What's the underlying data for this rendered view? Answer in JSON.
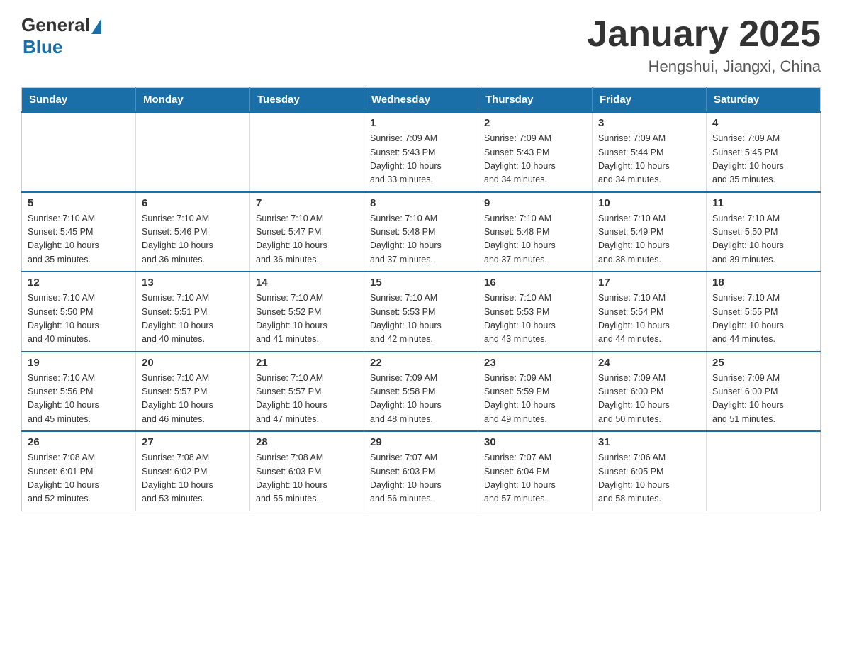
{
  "logo": {
    "general": "General",
    "blue": "Blue"
  },
  "title": "January 2025",
  "subtitle": "Hengshui, Jiangxi, China",
  "days_of_week": [
    "Sunday",
    "Monday",
    "Tuesday",
    "Wednesday",
    "Thursday",
    "Friday",
    "Saturday"
  ],
  "weeks": [
    [
      {
        "day": "",
        "info": ""
      },
      {
        "day": "",
        "info": ""
      },
      {
        "day": "",
        "info": ""
      },
      {
        "day": "1",
        "info": "Sunrise: 7:09 AM\nSunset: 5:43 PM\nDaylight: 10 hours\nand 33 minutes."
      },
      {
        "day": "2",
        "info": "Sunrise: 7:09 AM\nSunset: 5:43 PM\nDaylight: 10 hours\nand 34 minutes."
      },
      {
        "day": "3",
        "info": "Sunrise: 7:09 AM\nSunset: 5:44 PM\nDaylight: 10 hours\nand 34 minutes."
      },
      {
        "day": "4",
        "info": "Sunrise: 7:09 AM\nSunset: 5:45 PM\nDaylight: 10 hours\nand 35 minutes."
      }
    ],
    [
      {
        "day": "5",
        "info": "Sunrise: 7:10 AM\nSunset: 5:45 PM\nDaylight: 10 hours\nand 35 minutes."
      },
      {
        "day": "6",
        "info": "Sunrise: 7:10 AM\nSunset: 5:46 PM\nDaylight: 10 hours\nand 36 minutes."
      },
      {
        "day": "7",
        "info": "Sunrise: 7:10 AM\nSunset: 5:47 PM\nDaylight: 10 hours\nand 36 minutes."
      },
      {
        "day": "8",
        "info": "Sunrise: 7:10 AM\nSunset: 5:48 PM\nDaylight: 10 hours\nand 37 minutes."
      },
      {
        "day": "9",
        "info": "Sunrise: 7:10 AM\nSunset: 5:48 PM\nDaylight: 10 hours\nand 37 minutes."
      },
      {
        "day": "10",
        "info": "Sunrise: 7:10 AM\nSunset: 5:49 PM\nDaylight: 10 hours\nand 38 minutes."
      },
      {
        "day": "11",
        "info": "Sunrise: 7:10 AM\nSunset: 5:50 PM\nDaylight: 10 hours\nand 39 minutes."
      }
    ],
    [
      {
        "day": "12",
        "info": "Sunrise: 7:10 AM\nSunset: 5:50 PM\nDaylight: 10 hours\nand 40 minutes."
      },
      {
        "day": "13",
        "info": "Sunrise: 7:10 AM\nSunset: 5:51 PM\nDaylight: 10 hours\nand 40 minutes."
      },
      {
        "day": "14",
        "info": "Sunrise: 7:10 AM\nSunset: 5:52 PM\nDaylight: 10 hours\nand 41 minutes."
      },
      {
        "day": "15",
        "info": "Sunrise: 7:10 AM\nSunset: 5:53 PM\nDaylight: 10 hours\nand 42 minutes."
      },
      {
        "day": "16",
        "info": "Sunrise: 7:10 AM\nSunset: 5:53 PM\nDaylight: 10 hours\nand 43 minutes."
      },
      {
        "day": "17",
        "info": "Sunrise: 7:10 AM\nSunset: 5:54 PM\nDaylight: 10 hours\nand 44 minutes."
      },
      {
        "day": "18",
        "info": "Sunrise: 7:10 AM\nSunset: 5:55 PM\nDaylight: 10 hours\nand 44 minutes."
      }
    ],
    [
      {
        "day": "19",
        "info": "Sunrise: 7:10 AM\nSunset: 5:56 PM\nDaylight: 10 hours\nand 45 minutes."
      },
      {
        "day": "20",
        "info": "Sunrise: 7:10 AM\nSunset: 5:57 PM\nDaylight: 10 hours\nand 46 minutes."
      },
      {
        "day": "21",
        "info": "Sunrise: 7:10 AM\nSunset: 5:57 PM\nDaylight: 10 hours\nand 47 minutes."
      },
      {
        "day": "22",
        "info": "Sunrise: 7:09 AM\nSunset: 5:58 PM\nDaylight: 10 hours\nand 48 minutes."
      },
      {
        "day": "23",
        "info": "Sunrise: 7:09 AM\nSunset: 5:59 PM\nDaylight: 10 hours\nand 49 minutes."
      },
      {
        "day": "24",
        "info": "Sunrise: 7:09 AM\nSunset: 6:00 PM\nDaylight: 10 hours\nand 50 minutes."
      },
      {
        "day": "25",
        "info": "Sunrise: 7:09 AM\nSunset: 6:00 PM\nDaylight: 10 hours\nand 51 minutes."
      }
    ],
    [
      {
        "day": "26",
        "info": "Sunrise: 7:08 AM\nSunset: 6:01 PM\nDaylight: 10 hours\nand 52 minutes."
      },
      {
        "day": "27",
        "info": "Sunrise: 7:08 AM\nSunset: 6:02 PM\nDaylight: 10 hours\nand 53 minutes."
      },
      {
        "day": "28",
        "info": "Sunrise: 7:08 AM\nSunset: 6:03 PM\nDaylight: 10 hours\nand 55 minutes."
      },
      {
        "day": "29",
        "info": "Sunrise: 7:07 AM\nSunset: 6:03 PM\nDaylight: 10 hours\nand 56 minutes."
      },
      {
        "day": "30",
        "info": "Sunrise: 7:07 AM\nSunset: 6:04 PM\nDaylight: 10 hours\nand 57 minutes."
      },
      {
        "day": "31",
        "info": "Sunrise: 7:06 AM\nSunset: 6:05 PM\nDaylight: 10 hours\nand 58 minutes."
      },
      {
        "day": "",
        "info": ""
      }
    ]
  ]
}
